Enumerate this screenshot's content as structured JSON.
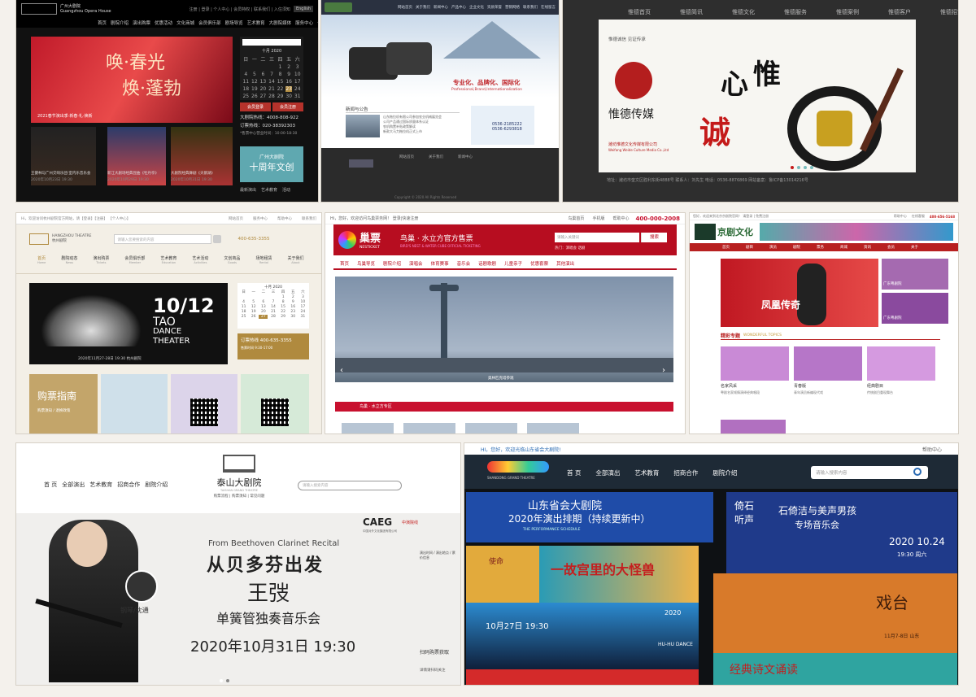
{
  "panel1": {
    "logo_en": "Guangzhou Opera House",
    "logo_cn": "广州大剧院",
    "top_links": "注册 | 登录 | 个人中心 | 会员特权 | 联系我们 | 入住须知",
    "lang": "English",
    "nav": [
      "首页",
      "剧院介绍",
      "演出购票",
      "优惠活动",
      "文化商城",
      "会员俱乐部",
      "剧场导览",
      "艺术教育",
      "大剧院媒体",
      "服务中心",
      "合作伙伴",
      "联系我们"
    ],
    "banner_title1": "唤·春光",
    "banner_title2": "焕·蓬勃",
    "banner_caption": "2021春节演出季·新春·礼·焕新",
    "month": "十月 2020",
    "weekdays": [
      "日",
      "一",
      "二",
      "三",
      "四",
      "五",
      "六"
    ],
    "days": [
      "",
      "",
      "",
      "",
      "1",
      "2",
      "3",
      "4",
      "5",
      "6",
      "7",
      "8",
      "9",
      "10",
      "11",
      "12",
      "13",
      "14",
      "15",
      "16",
      "17",
      "18",
      "19",
      "20",
      "21",
      "22",
      "23",
      "24",
      "25",
      "26",
      "27",
      "28",
      "29",
      "30",
      "31"
    ],
    "member_login": "会员登录",
    "member_register": "会员注册",
    "hotline": "大剧院热线：4008-808-922",
    "phone": "订票热线：020-38392303",
    "hours": "*售票中心营业时间：10:00-18:30",
    "promo_small": "广州大剧院",
    "promo_big": "十周年文创",
    "bottom_tabs": [
      "最新演出",
      "艺术教育",
      "活动"
    ],
    "show1": "王健林与广州交响乐团·室内乐音乐会",
    "show1_date": "2020年10月23日 19:30",
    "show2": "新江大剧场经典昆曲《牡丹亭》",
    "show2_date": "2020年10月29日 19:30",
    "show3": "大剧院经典舞剧《天鹅湖》",
    "show3_date": "2020年10月31日 19:30"
  },
  "panel2": {
    "nav": [
      "网站首页",
      "关于我们",
      "新闻中心",
      "产品中心",
      "企业文化",
      "资质荣誉",
      "营销网络",
      "联系我们",
      "在线留言"
    ],
    "slogan": "专业化、品牌化、国际化",
    "slogan_en": "Professional,Brand,Internationalization",
    "news_title": "新闻与公告",
    "news_items": [
      "山东拖拉机有限公司参加农业机械展览会",
      "公司产品通过国际质量体系认证",
      "农机购置补贴政策解读",
      "新款大马力拖拉机正式上市"
    ],
    "tel1": "0536-2185222",
    "tel2": "0536-6293818",
    "footer_cols": [
      "网站首页",
      "关于我们",
      "新闻中心"
    ],
    "copyright": "Copyright © 2020 All Rights Reserved"
  },
  "panel3": {
    "nav": [
      "惟德首页",
      "惟德简讯",
      "惟德文化",
      "惟德服务",
      "惟德案例",
      "惟德客户",
      "惟德招贤"
    ],
    "brand_cn": "惟德传媒",
    "brand_sub": "潍坊惟德文化传媒有限公司",
    "brand_en": "Weifang Weide Culture Media Co.,Ltd",
    "slogan_small": "惟德诚信 见证传承",
    "calligraphy": [
      "心",
      "惟",
      "诚"
    ],
    "footer": "地址：潍坊市奎文区胜利东街4888号 联系人：刘先生 电话：0536-8876869 网站备案：鲁ICP备13014216号"
  },
  "panel4": {
    "top_left": "Hi，欢迎访问杭州剧院官方网站，请【登录】【注册】 【个人中心】",
    "top_right": [
      "网站首页",
      "服务中心",
      "帮助中心",
      "联系我们"
    ],
    "logo_en": "HANGZHOU THEATRE",
    "logo_cn": "杭州剧院",
    "search_placeholder": "请输入您要搜索的内容",
    "phone": "400-635-3355",
    "nav": [
      "首页",
      "剧院动态",
      "演出购票",
      "会员俱乐部",
      "艺术教育",
      "艺术活动",
      "文创商品",
      "场地租赁",
      "关于我们"
    ],
    "nav_en": [
      "Home",
      "News",
      "Tickets",
      "Member",
      "Education",
      "Activities",
      "Goods",
      "Rental",
      "About"
    ],
    "banner_big": "10/12",
    "banner_sub1": "TAO",
    "banner_sub2": "DANCE",
    "banner_sub3": "THEATER",
    "banner_caption": "2020年11月27-28日 19:30 杭州剧院",
    "month": "十月 2020",
    "weekdays": [
      "日",
      "一",
      "二",
      "三",
      "四",
      "五",
      "六"
    ],
    "days": [
      "",
      "",
      "",
      "",
      "1",
      "2",
      "3",
      "4",
      "5",
      "6",
      "7",
      "8",
      "9",
      "10",
      "11",
      "12",
      "13",
      "14",
      "15",
      "16",
      "17",
      "18",
      "19",
      "20",
      "21",
      "22",
      "23",
      "24",
      "25",
      "26",
      "27",
      "28",
      "29",
      "30",
      "31"
    ],
    "ticket_hotline": "订票热线 400-635-3355",
    "ticket_hours": "售票时间 9:30-17:00",
    "guide_title": "购票指南",
    "guide_sub": "购票须知 / 退换政策"
  },
  "panel5": {
    "top_left": "Hi，您好，欢迎访问鸟巢票务网！ 登录|快速注册",
    "top_links": [
      "鸟巢首页",
      "手机版",
      "帮助中心"
    ],
    "phone": "400-000-2008",
    "logo_cn": "巢票",
    "logo_en": "NESTICKET",
    "title": "鸟巢 · 水立方官方售票",
    "title_en": "BIRD'S NEST & WATER CUBE OFFICIAL TICKETING",
    "search_placeholder": "请输入关键词",
    "search_button": "搜索",
    "hot": "热门：演唱会 话剧",
    "nav": [
      "首页",
      "鸟巢导览",
      "剧院介绍",
      "演唱会",
      "体育赛事",
      "音乐会",
      "话剧歌剧",
      "儿童亲子",
      "优惠套票",
      "其他演出"
    ],
    "banner_caption": "奥林匹克塔参观",
    "section": "鸟巢 · 水立方专区"
  },
  "panel6": {
    "top_left": "您好，欢迎来到北京京剧院官网！ 请登录 | 免费注册",
    "top_right": [
      "帮助中心",
      "在线客服"
    ],
    "phone": "400-656-5168",
    "brand": "京剧文化",
    "nav": [
      "首页",
      "剧目",
      "演员",
      "剧院",
      "票务",
      "商城",
      "资讯",
      "会员",
      "关于"
    ],
    "banner_text": "凤凰传奇",
    "side_items": [
      "广东粤剧院",
      "广东粤剧院"
    ],
    "topics_cn": "精彩专题",
    "topics_en": "WONDERFUL TOPICS",
    "topic_titles": [
      "名家风采",
      "青春版",
      "经典剧目"
    ],
    "topic_texts": [
      "粤剧名家倾情演绎经典唱段",
      "青年演员新编现代戏",
      "传统剧目重现舞台"
    ]
  },
  "panel7": {
    "nav": [
      "首 页",
      "全部演出",
      "艺术教育",
      "招商合作",
      "剧院介绍"
    ],
    "logo_cn": "泰山大剧院",
    "logo_en": "TAISHAN GRAND THEATRE",
    "sub_links": "购票流程 | 购票须知 | 常见问题",
    "search_placeholder": "请输入搜索内容",
    "caeg": "CAEG",
    "caeg_sub": "中国对外文化集团有限公司",
    "partner": "中演院线",
    "recital_en": "From Beethoven Clarinet Recital",
    "title1": "从贝多芬出发",
    "performer": "王弢",
    "concert": "单簧管独奏音乐会",
    "datetime": "2020年10月31日 19:30",
    "pianist": "钢琴/沈通",
    "qr_text": "扫码购票获取",
    "qr_note": "详情请扫码关注",
    "side_text": "演出时间 / 演出地点 / 票价信息"
  },
  "panel8": {
    "top_left": "HI，您好，欢迎光临山东省会大剧院!",
    "help": "帮助中心",
    "nav": [
      "首 页",
      "全部演出",
      "艺术教育",
      "招商合作",
      "剧院介绍"
    ],
    "search_placeholder": "请输入搜索内容",
    "logo_en": "SHANDONG GRAND THEATRE",
    "poster1_a": "山东省会大剧院",
    "poster1_b": "2020年演出排期（持续更新中）",
    "poster1_c": "THE PERFORMANCE SCHEDULE",
    "poster2_cn": "倚石听声",
    "poster2_a": "石倚洁与美声男孩",
    "poster2_b": "专场音乐会",
    "poster2_date": "2020 10.24",
    "poster2_time": "19:30 周六",
    "poster3": "使命",
    "poster4": "一故宫里的大怪兽",
    "poster5_date": "10月27日 19:30",
    "poster5_tag": "HU-HU DANCE",
    "poster5_year": "2020",
    "poster6": "戏台",
    "poster6_date": "11月7-8日 山东",
    "poster7": "经典诗文诵读"
  },
  "colors": {
    "red": "#c8102e",
    "gold": "#b08a3e",
    "dark": "#1a1a1a",
    "blue": "#2a6bb3"
  }
}
